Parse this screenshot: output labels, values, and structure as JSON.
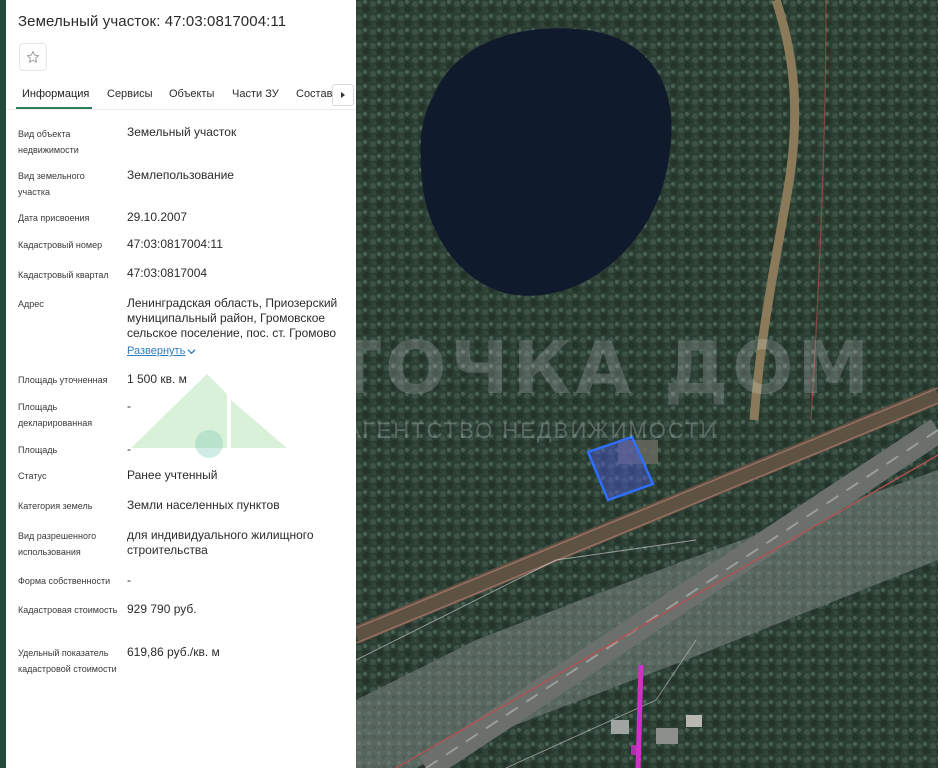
{
  "panel": {
    "title": "Земельный участок: 47:03:0817004:11",
    "favorite_icon": "star-outline-icon"
  },
  "tabs": [
    {
      "label": "Информация",
      "active": true
    },
    {
      "label": "Сервисы",
      "active": false
    },
    {
      "label": "Объекты",
      "active": false
    },
    {
      "label": "Части ЗУ",
      "active": false
    },
    {
      "label": "Состав",
      "active": false
    }
  ],
  "tabs_scroll_icon": "caret-right-icon",
  "info": {
    "object_type": {
      "label": "Вид объекта недвижимости",
      "value": "Земельный участок"
    },
    "land_type": {
      "label": "Вид земельного участка",
      "value": "Землепользование"
    },
    "assign_date": {
      "label": "Дата присвоения",
      "value": "29.10.2007"
    },
    "cadastral_number": {
      "label": "Кадастровый номер",
      "value": "47:03:0817004:11"
    },
    "cadastral_quarter": {
      "label": "Кадастровый квартал",
      "value": "47:03:0817004"
    },
    "address": {
      "label": "Адрес",
      "value": "Ленинградская область, Приозерский муниципальный район, Громовское сельское поселение, пос. ст. Громово",
      "expand": "Развернуть"
    },
    "area_specified": {
      "label": "Площадь уточненная",
      "value": "1 500 кв. м"
    },
    "area_declared": {
      "label": "Площадь декларированная",
      "value": "-"
    },
    "area": {
      "label": "Площадь",
      "value": "-"
    },
    "status": {
      "label": "Статус",
      "value": "Ранее учтенный"
    },
    "category": {
      "label": "Категория земель",
      "value": "Земли населенных пунктов"
    },
    "permitted_use": {
      "label": "Вид разрешенного использования",
      "value": "для индивидуального жилищного строительства"
    },
    "ownership": {
      "label": "Форма собственности",
      "value": "-"
    },
    "cadastral_value": {
      "label": "Кадастровая стоимость",
      "value": "929 790 руб."
    },
    "specific_value": {
      "label": "Удельный показатель кадастровой стоимости",
      "value": "619,86 руб./кв. м"
    }
  },
  "watermark": {
    "title": "ТОЧКА ДОМ",
    "subtitle": "АГЕНТСТВО НЕДВИЖИМОСТИ"
  },
  "colors": {
    "accent": "#2e7d5b",
    "link": "#2f7db8",
    "parcel": "#2f6fff"
  }
}
